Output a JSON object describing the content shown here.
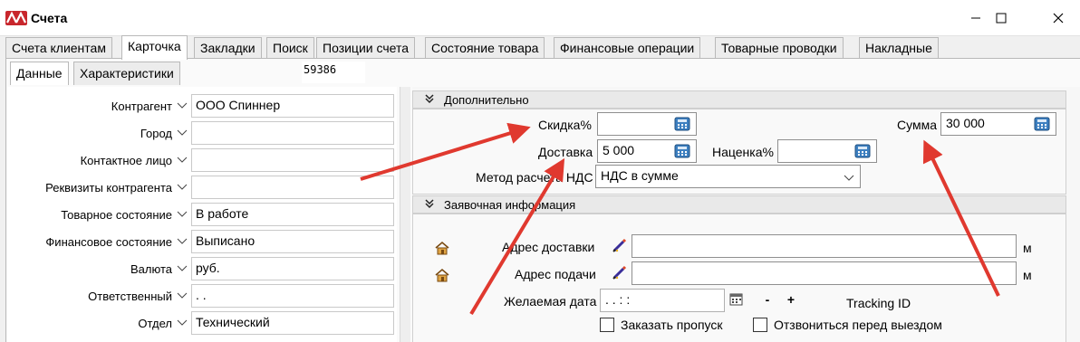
{
  "window": {
    "title": "Счета",
    "app_icon": "app-logo-icon"
  },
  "tabs": [
    {
      "label": "Счета клиентам",
      "active": false
    },
    {
      "label": "Карточка",
      "active": true
    },
    {
      "label": "Закладки",
      "active": false
    },
    {
      "label": "Поиск",
      "active": false
    },
    {
      "label": "Позиции счета",
      "active": false
    },
    {
      "label": "Состояние товара",
      "active": false
    },
    {
      "label": "Финансовые операции",
      "active": false
    },
    {
      "label": "Товарные проводки",
      "active": false
    },
    {
      "label": "Накладные",
      "active": false
    }
  ],
  "subtabs": [
    {
      "label": "Данные",
      "active": true
    },
    {
      "label": "Характеристики",
      "active": false
    }
  ],
  "record_id": "59386",
  "left_form": [
    {
      "label": "Контрагент",
      "value": "ООО Спиннер"
    },
    {
      "label": "Город",
      "value": ""
    },
    {
      "label": "Контактное лицо",
      "value": ""
    },
    {
      "label": "Реквизиты контрагента",
      "value": ""
    },
    {
      "label": "Товарное состояние",
      "value": "В работе"
    },
    {
      "label": "Финансовое состояние",
      "value": "Выписано"
    },
    {
      "label": "Валюта",
      "value": "руб."
    },
    {
      "label": "Ответственный",
      "value": ". ."
    },
    {
      "label": "Отдел",
      "value": "Технический"
    }
  ],
  "additional": {
    "header": "Дополнительно",
    "discount_label": "Скидка%",
    "discount_value": "",
    "delivery_label": "Доставка",
    "delivery_value": "5 000",
    "markup_label": "Наценка%",
    "markup_value": "",
    "sum_label": "Сумма",
    "sum_value": "30 000",
    "vat_method_label": "Метод расчета НДС",
    "vat_method_value": "НДС в сумме"
  },
  "request_info": {
    "header": "Заявочная информация",
    "delivery_address_label": "Адрес доставки",
    "delivery_address_value": "",
    "delivery_address_unit": "м",
    "pickup_address_label": "Адрес подачи",
    "pickup_address_value": "",
    "pickup_address_unit": "м",
    "desired_date_label": "Желаемая дата",
    "desired_date_value": ".   .       :   :",
    "minus_label": "-",
    "plus_label": "+",
    "tracking_label": "Tracking ID",
    "pass_label": "Заказать пропуск",
    "pass_checked": false,
    "call_label": "Отзвониться перед выездом",
    "call_checked": false
  },
  "colors": {
    "arrow": "#e0392f",
    "accent": "#c8262c"
  }
}
